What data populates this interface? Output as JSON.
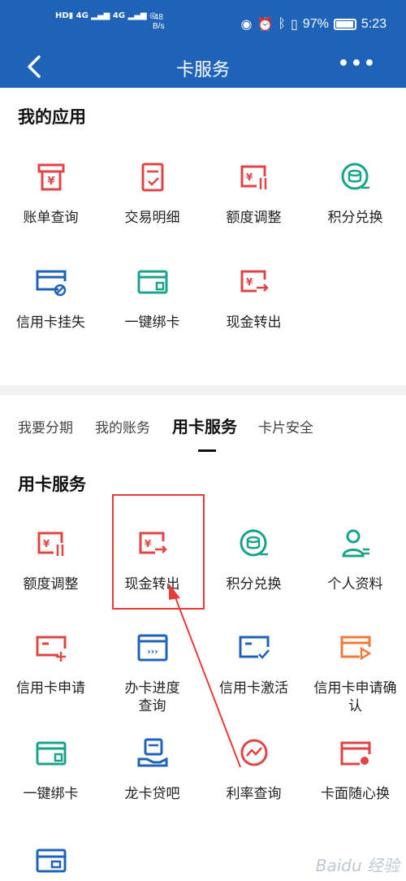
{
  "status": {
    "signal_left": "HD 1 4G\nHD 2",
    "net_speed": "48",
    "net_unit": "B/s",
    "battery": "97%",
    "time": "5:23"
  },
  "nav": {
    "title": "卡服务",
    "back_icon": "chevron-left-icon",
    "more_icon": "more-dots-icon",
    "more_glyph": "•••"
  },
  "my_apps": {
    "title": "我的应用",
    "items": [
      {
        "label": "账单查询",
        "icon": "bill-icon",
        "color": "#e04545"
      },
      {
        "label": "交易明细",
        "icon": "receipt-icon",
        "color": "#e04545"
      },
      {
        "label": "额度调整",
        "icon": "limit-adjust-icon",
        "color": "#e04545"
      },
      {
        "label": "积分兑换",
        "icon": "points-icon",
        "color": "#1aa38a"
      },
      {
        "label": "信用卡挂失",
        "icon": "card-block-icon",
        "color": "#1f63b9"
      },
      {
        "label": "一键绑卡",
        "icon": "card-bind-icon",
        "color": "#1aa38a"
      },
      {
        "label": "现金转出",
        "icon": "cash-out-icon",
        "color": "#e04545"
      }
    ]
  },
  "tabs": {
    "items": [
      "我要分期",
      "我的账务",
      "用卡服务",
      "卡片安全"
    ],
    "active": "用卡服务"
  },
  "card_service": {
    "title": "用卡服务",
    "items": [
      {
        "label": "额度调整",
        "icon": "limit-adjust-icon",
        "color": "#e04545"
      },
      {
        "label": "现金转出",
        "icon": "cash-out-icon",
        "color": "#e04545"
      },
      {
        "label": "积分兑换",
        "icon": "points-icon",
        "color": "#1aa38a"
      },
      {
        "label": "个人资料",
        "icon": "profile-icon",
        "color": "#1aa38a"
      },
      {
        "label": "信用卡申请",
        "icon": "card-apply-icon",
        "color": "#e04545"
      },
      {
        "label": "办卡进度\n查询",
        "icon": "progress-icon",
        "color": "#1f63b9"
      },
      {
        "label": "信用卡激活",
        "icon": "card-activate-icon",
        "color": "#1f63b9"
      },
      {
        "label": "信用卡申请确\n认",
        "icon": "apply-confirm-icon",
        "color": "#f07a3a"
      },
      {
        "label": "一键绑卡",
        "icon": "card-bind-icon",
        "color": "#1aa38a"
      },
      {
        "label": "龙卡贷吧",
        "icon": "loan-icon",
        "color": "#1f63b9"
      },
      {
        "label": "利率查询",
        "icon": "rate-icon",
        "color": "#e04545"
      },
      {
        "label": "卡面随心换",
        "icon": "card-face-icon",
        "color": "#e04545"
      }
    ]
  },
  "watermark": "Baidu 经验"
}
